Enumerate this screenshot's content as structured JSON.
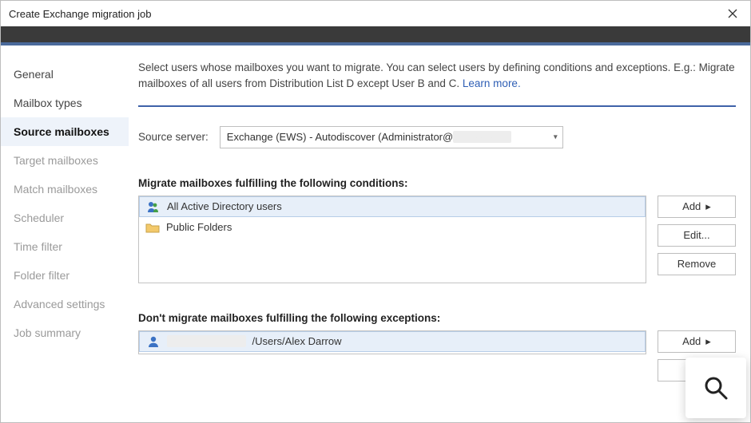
{
  "window": {
    "title": "Create Exchange migration job"
  },
  "sidebar": {
    "items": [
      {
        "label": "General",
        "enabled": true
      },
      {
        "label": "Mailbox types",
        "enabled": true
      },
      {
        "label": "Source mailboxes",
        "enabled": true,
        "active": true
      },
      {
        "label": "Target mailboxes",
        "enabled": false
      },
      {
        "label": "Match mailboxes",
        "enabled": false
      },
      {
        "label": "Scheduler",
        "enabled": false
      },
      {
        "label": "Time filter",
        "enabled": false
      },
      {
        "label": "Folder filter",
        "enabled": false
      },
      {
        "label": "Advanced settings",
        "enabled": false
      },
      {
        "label": "Job summary",
        "enabled": false
      }
    ]
  },
  "intro": {
    "text": "Select users whose mailboxes you want to migrate. You can select users by defining conditions and exceptions. E.g.: Migrate mailboxes of all users from Distribution List D except User B and C. ",
    "learn_more": "Learn more."
  },
  "server": {
    "label": "Source server:",
    "selected": "Exchange (EWS) - Autodiscover (Administrator@"
  },
  "sections": {
    "conditions_title": "Migrate mailboxes fulfilling the following conditions:",
    "exceptions_title": "Don't migrate mailboxes fulfilling the following exceptions:"
  },
  "conditions": {
    "rows": [
      {
        "icon": "users-icon",
        "text": "All Active Directory users",
        "selected": true
      },
      {
        "icon": "folder-icon",
        "text": "Public Folders",
        "selected": false
      }
    ]
  },
  "exceptions": {
    "rows": [
      {
        "icon": "user-icon",
        "suffix": "/Users/Alex Darrow",
        "selected": true
      }
    ]
  },
  "buttons": {
    "add": "Add",
    "edit": "Edit...",
    "remove": "Remove"
  }
}
